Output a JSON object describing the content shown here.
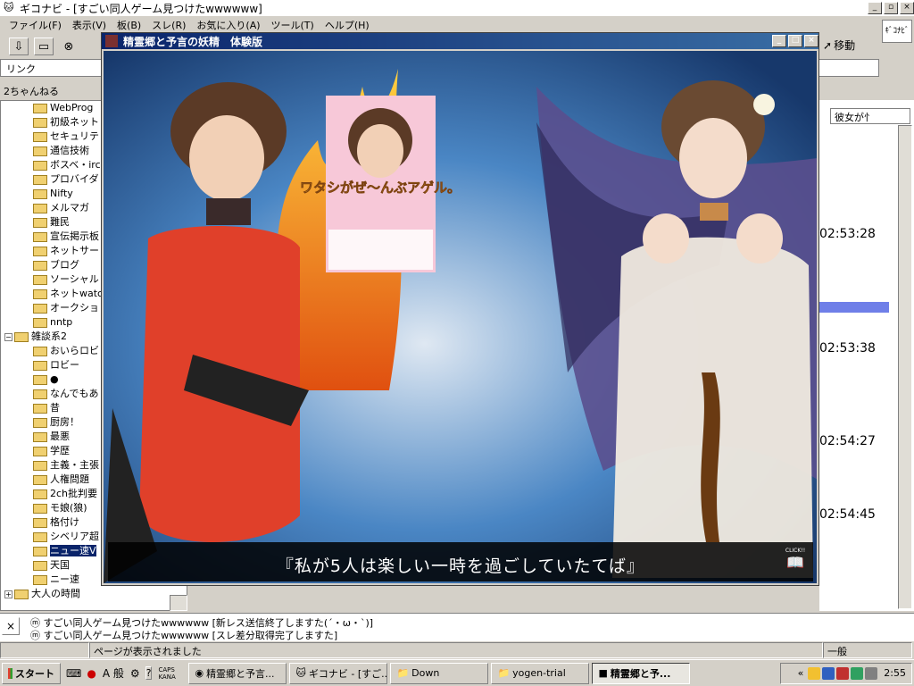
{
  "app": {
    "title": "ギコナビ - [すごい同人ゲーム見つけたwwwwww]",
    "logo_text": "ｷﾞｺﾅﾋﾞ"
  },
  "menu": {
    "items": [
      "ファイル(F)",
      "表示(V)",
      "板(B)",
      "スレ(R)",
      "お気に入り(A)",
      "ツール(T)",
      "ヘルプ(H)"
    ]
  },
  "toolbar": {
    "move_label": "移動"
  },
  "linkbar": {
    "label": "リンク"
  },
  "tree": {
    "header": "2ちゃんねる",
    "items": [
      {
        "label": "WebProg",
        "indent": 2
      },
      {
        "label": "初級ネット",
        "indent": 2
      },
      {
        "label": "セキュリテ",
        "indent": 2
      },
      {
        "label": "通信技術",
        "indent": 2
      },
      {
        "label": "ボスベ・irc",
        "indent": 2
      },
      {
        "label": "プロバイダ",
        "indent": 2
      },
      {
        "label": "Nifty",
        "indent": 2
      },
      {
        "label": "メルマガ",
        "indent": 2
      },
      {
        "label": "難民",
        "indent": 2
      },
      {
        "label": "宣伝掲示板",
        "indent": 2
      },
      {
        "label": "ネットサー",
        "indent": 2
      },
      {
        "label": "ブログ",
        "indent": 2
      },
      {
        "label": "ソーシャル",
        "indent": 2
      },
      {
        "label": "ネットwatch",
        "indent": 2
      },
      {
        "label": "オークショ",
        "indent": 2
      },
      {
        "label": "nntp",
        "indent": 2
      },
      {
        "label": "雑談系2",
        "indent": 1,
        "expander": "−"
      },
      {
        "label": "おいらロビ",
        "indent": 2
      },
      {
        "label": "ロビー",
        "indent": 2
      },
      {
        "label": "●",
        "indent": 2
      },
      {
        "label": "なんでもあ",
        "indent": 2
      },
      {
        "label": "昔",
        "indent": 2
      },
      {
        "label": "厨房！",
        "indent": 2
      },
      {
        "label": "最悪",
        "indent": 2
      },
      {
        "label": "学歴",
        "indent": 2
      },
      {
        "label": "主義・主張",
        "indent": 2
      },
      {
        "label": "人権問題",
        "indent": 2
      },
      {
        "label": "2ch批判要",
        "indent": 2
      },
      {
        "label": "モ娘(狼)",
        "indent": 2
      },
      {
        "label": "格付け",
        "indent": 2
      },
      {
        "label": "シベリア超",
        "indent": 2
      },
      {
        "label": "ニュー速V",
        "indent": 2,
        "selected": true
      },
      {
        "label": "天国",
        "indent": 2
      },
      {
        "label": "ニー速",
        "indent": 2
      },
      {
        "label": "大人の時間",
        "indent": 1,
        "expander": "+"
      }
    ]
  },
  "right_pane": {
    "header": "彼女が忄",
    "times": [
      "02:53:28",
      "02:53:38",
      "02:54:27",
      "02:54:45"
    ]
  },
  "log": {
    "lines": [
      "すごい同人ゲーム見つけたwwwwww [新レス送信終了しますた(´・ω・`)]",
      "すごい同人ゲーム見つけたwwwwww [スレ差分取得完了しますた]"
    ]
  },
  "status": {
    "message": "ページが表示されました",
    "mode": "一般"
  },
  "game": {
    "title": "精霊郷と予言の妖精　体験版",
    "dialogue": "『私が5人は楽しい一時を過ごしていたてば』",
    "click_label": "CLICK!!",
    "cover_text": "ワタシがぜ〜んぶアゲル。"
  },
  "taskbar": {
    "start": "スタート",
    "ime": "A 般",
    "caps": "CAPS KANA",
    "tasks": [
      {
        "label": "精霊郷と予言...",
        "active": false
      },
      {
        "label": "ギコナビ - [すご...",
        "active": false
      },
      {
        "label": "Down",
        "active": false
      },
      {
        "label": "yogen-trial",
        "active": false
      },
      {
        "label": "精霊郷と予...",
        "active": true
      }
    ],
    "clock": "2:55"
  }
}
